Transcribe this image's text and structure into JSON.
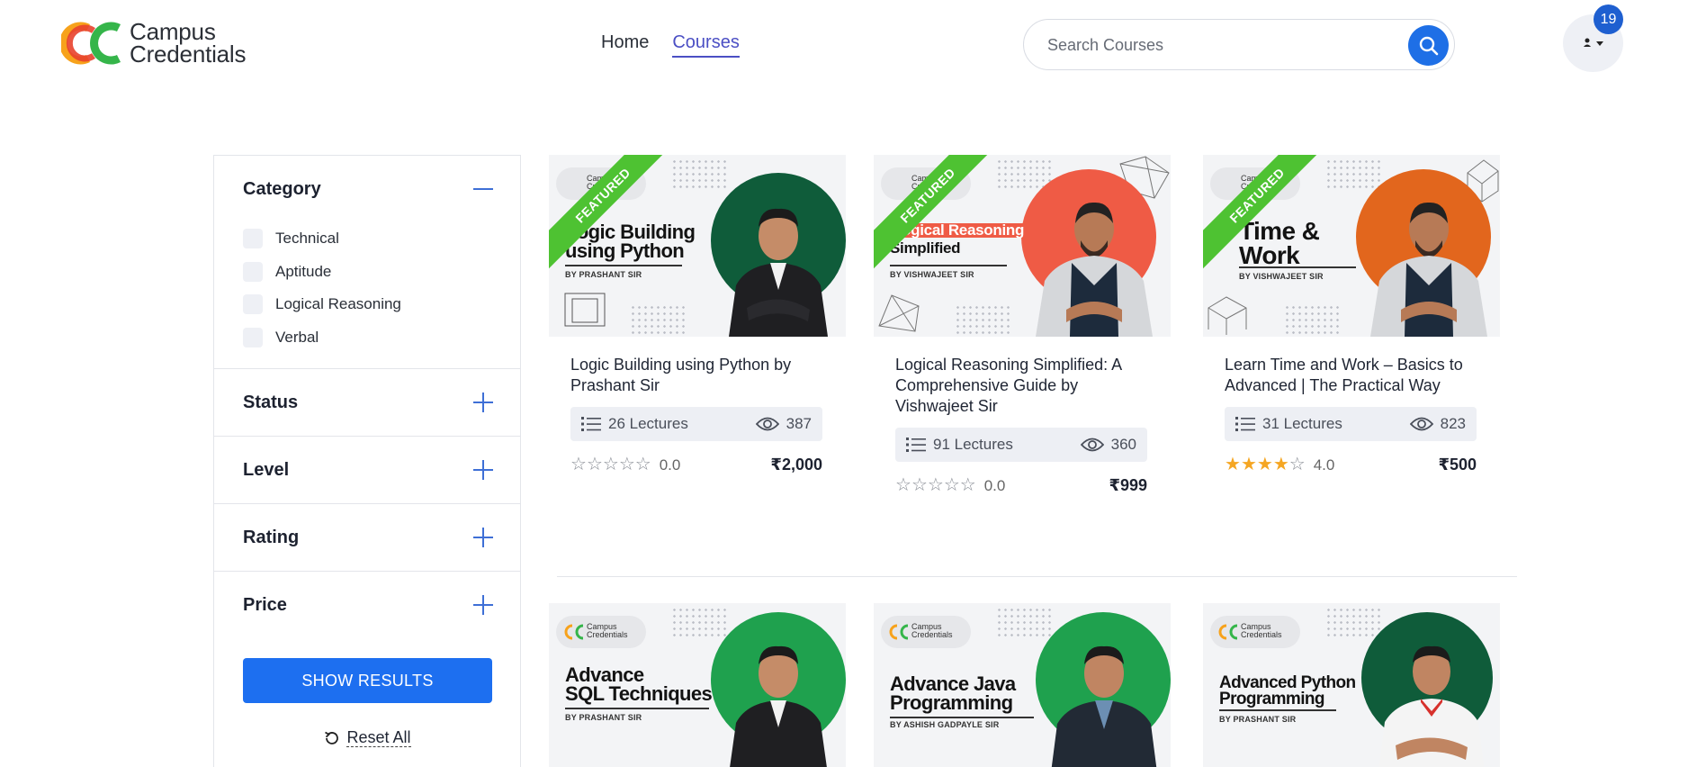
{
  "header": {
    "logo_line1": "Campus",
    "logo_line2": "Credentials",
    "nav": [
      {
        "label": "Home",
        "active": false
      },
      {
        "label": "Courses",
        "active": true
      }
    ],
    "search_placeholder": "Search Courses",
    "notification_count": "19",
    "accent_color": "#1e6fe6"
  },
  "sidebar": {
    "category": {
      "title": "Category",
      "expanded": true,
      "options": [
        "Technical",
        "Aptitude",
        "Logical Reasoning",
        "Verbal"
      ]
    },
    "collapsed_filters": [
      "Status",
      "Level",
      "Rating",
      "Price"
    ],
    "show_results": "SHOW RESULTS",
    "reset_all": "Reset All"
  },
  "thumb_logo": {
    "line1": "Campus",
    "line2": "Credentials"
  },
  "featured_label": "FEATURED",
  "courses": [
    {
      "thumb_title_1": "Logic Building",
      "thumb_title_2": "using Python",
      "thumb_by": "BY PRASHANT SIR",
      "circle_color": "#0f5c3a",
      "title": "Logic Building using Python by Prashant Sir",
      "lectures": "26 Lectures",
      "views": "387",
      "rating": "0.0",
      "rating_value": 0,
      "price": "₹2,000",
      "featured": true
    },
    {
      "thumb_title_1": "Logical Reasoning",
      "thumb_title_2": "Simplified",
      "thumb_by": "BY VISHWAJEET SIR",
      "circle_color": "#ef5b45",
      "title": "Logical Reasoning Simplified: A Comprehensive Guide by Vishwajeet Sir",
      "lectures": "91 Lectures",
      "views": "360",
      "rating": "0.0",
      "rating_value": 0,
      "price": "₹999",
      "featured": true
    },
    {
      "thumb_title_1": "Time &",
      "thumb_title_2": "Work",
      "thumb_by": "BY VISHWAJEET SIR",
      "circle_color": "#e2661d",
      "title": "Learn Time and Work – Basics to Advanced | The Practical Way",
      "lectures": "31 Lectures",
      "views": "823",
      "rating": "4.0",
      "rating_value": 4,
      "price": "₹500",
      "featured": true
    },
    {
      "thumb_title_1": "Advance",
      "thumb_title_2": "SQL Techniques",
      "thumb_by": "BY PRASHANT SIR",
      "circle_color": "#1fa14e",
      "featured": false
    },
    {
      "thumb_title_1": "Advance Java",
      "thumb_title_2": "Programming",
      "thumb_by": "BY ASHISH GADPAYLE SIR",
      "circle_color": "#1fa14e",
      "featured": false
    },
    {
      "thumb_title_1": "Advanced Python",
      "thumb_title_2": "Programming",
      "thumb_by": "BY PRASHANT SIR",
      "circle_color": "#0f5c3a",
      "featured": false
    }
  ]
}
